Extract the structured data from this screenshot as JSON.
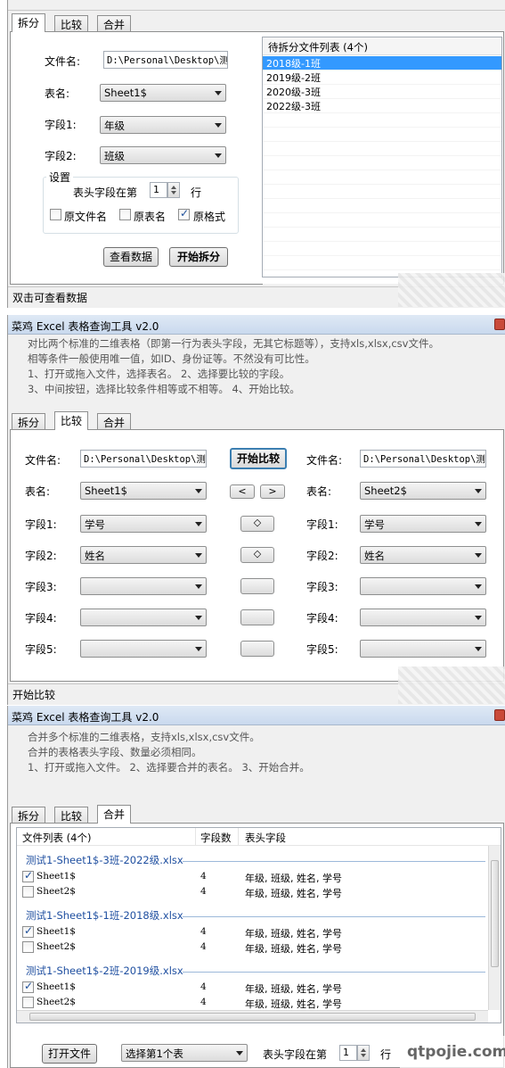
{
  "section1": {
    "tabs": [
      "拆分",
      "比较",
      "合并"
    ],
    "file_label": "文件名:",
    "file_value": "D:\\Personal\\Desktop\\测试",
    "table_label": "表名:",
    "table_value": "Sheet1$",
    "field1_label": "字段1:",
    "field1_value": "年级",
    "field2_label": "字段2:",
    "field2_value": "班级",
    "settings_label": "设置",
    "header_row_prefix": "表头字段在第",
    "header_row_value": "1",
    "header_row_suffix": "行",
    "opt_filename": "原文件名",
    "opt_filename_checked": false,
    "opt_tablename": "原表名",
    "opt_tablename_checked": false,
    "opt_format": "原格式",
    "opt_format_checked": true,
    "view_btn": "查看数据",
    "start_btn": "开始拆分",
    "list_header": "待拆分文件列表 (4个)",
    "list_items": [
      "2018级-1班",
      "2019级-2班",
      "2020级-3班",
      "2022级-3班"
    ],
    "status": "双击可查看数据"
  },
  "section2": {
    "title": "菜鸡 Excel 表格查询工具 v2.0",
    "desc": [
      "对比两个标准的二维表格（即第一行为表头字段，无其它标题等），支持xls,xlsx,csv文件。",
      "相等条件一般使用唯一值，如ID、身份证等。不然没有可比性。",
      "1、打开或拖入文件，选择表名。  2、选择要比较的字段。",
      "3、中间按钮，选择比较条件相等或不相等。  4、开始比较。"
    ],
    "tabs": [
      "拆分",
      "比较",
      "合并"
    ],
    "file_label": "文件名:",
    "left_file": "D:\\Personal\\Desktop\\测试",
    "right_file": "D:\\Personal\\Desktop\\测试",
    "start_btn": "开始比较",
    "table_label": "表名:",
    "left_table": "Sheet1$",
    "right_table": "Sheet2$",
    "nav_prev": "<",
    "nav_next": ">",
    "field_labels": [
      "字段1:",
      "字段2:",
      "字段3:",
      "字段4:",
      "字段5:"
    ],
    "left_fields": [
      "学号",
      "姓名",
      "",
      "",
      ""
    ],
    "right_fields": [
      "学号",
      "姓名",
      "",
      "",
      ""
    ],
    "cond_labels": [
      "◇",
      "◇",
      "",
      "",
      ""
    ],
    "status": "开始比较"
  },
  "section3": {
    "title": "菜鸡 Excel 表格查询工具 v2.0",
    "desc": [
      "合并多个标准的二维表格，支持xls,xlsx,csv文件。",
      "合并的表格表头字段、数量必须相同。",
      "1、打开或拖入文件。  2、选择要合并的表名。 3、开始合并。"
    ],
    "tabs": [
      "拆分",
      "比较",
      "合并"
    ],
    "col_headers": [
      "文件列表 (4个)",
      "字段数",
      "表头字段"
    ],
    "groups": [
      {
        "name": "测试1-Sheet1$-3班-2022级.xlsx",
        "rows": [
          {
            "sheet": "Sheet1$",
            "checked": true,
            "count": "4",
            "fields": "年级, 班级, 姓名, 学号"
          },
          {
            "sheet": "Sheet2$",
            "checked": false,
            "count": "4",
            "fields": "年级, 班级, 姓名, 学号"
          }
        ]
      },
      {
        "name": "测试1-Sheet1$-1班-2018级.xlsx",
        "rows": [
          {
            "sheet": "Sheet1$",
            "checked": true,
            "count": "4",
            "fields": "年级, 班级, 姓名, 学号"
          },
          {
            "sheet": "Sheet2$",
            "checked": false,
            "count": "4",
            "fields": "年级, 班级, 姓名, 学号"
          }
        ]
      },
      {
        "name": "测试1-Sheet1$-2班-2019级.xlsx",
        "rows": [
          {
            "sheet": "Sheet1$",
            "checked": true,
            "count": "4",
            "fields": "年级, 班级, 姓名, 学号"
          },
          {
            "sheet": "Sheet2$",
            "checked": false,
            "count": "4",
            "fields": "年级, 班级, 姓名, 学号"
          }
        ]
      }
    ],
    "open_btn": "打开文件",
    "select_value": "选择第1个表",
    "header_row_prefix": "表头字段在第",
    "header_row_value": "1",
    "header_row_suffix": "行",
    "watermark": "qtpojie.com"
  }
}
